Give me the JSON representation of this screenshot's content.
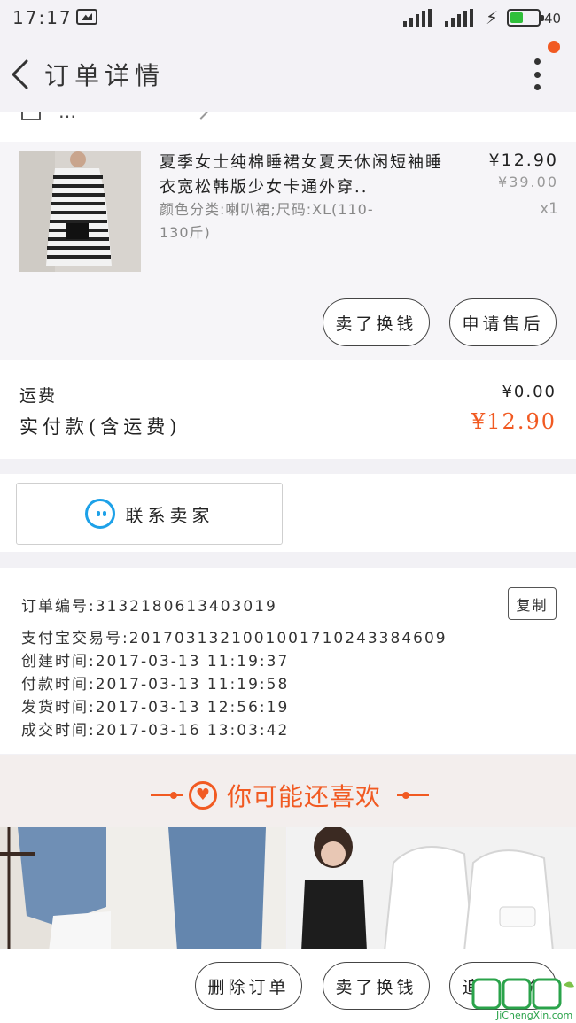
{
  "status_bar": {
    "time": "17:17",
    "battery_level": "40",
    "battery_fraction": 0.46
  },
  "header": {
    "title": "订单详情"
  },
  "cut_row": {
    "text": "…"
  },
  "product": {
    "title": "夏季女士纯棉睡裙女夏天休闲短袖睡衣宽松韩版少女卡通外穿..",
    "sku": "颜色分类:喇叭裙;尺码:XL(110-130斤)",
    "price": "¥12.90",
    "original_price": "¥39.00",
    "quantity": "x1",
    "buttons": {
      "sold": "卖了换钱",
      "after_sale": "申请售后"
    }
  },
  "shipping": {
    "fee_label": "运费",
    "fee_value": "¥0.00",
    "paid_label": "实付款(含运费)",
    "paid_value": "¥12.90"
  },
  "contact": {
    "label": "联系卖家"
  },
  "order_info": {
    "order_no": "订单编号:3132180613403019",
    "alipay_no": "支付宝交易号:2017031321001001710243384609",
    "created": "创建时间:2017-03-13  11:19:37",
    "paid": "付款时间:2017-03-13  11:19:58",
    "shipped": "发货时间:2017-03-13  12:56:19",
    "completed": "成交时间:2017-03-16  13:03:42",
    "copy_label": "复制"
  },
  "recommend": {
    "title": "你可能还喜欢"
  },
  "bottom_bar": {
    "delete": "删除订单",
    "sold": "卖了换钱",
    "review": "追加评价"
  },
  "watermark": {
    "text": "JiChengXin.com"
  },
  "colors": {
    "accent": "#f15a22",
    "chat_blue": "#1da1e8",
    "battery_green": "#2fbf3a"
  }
}
